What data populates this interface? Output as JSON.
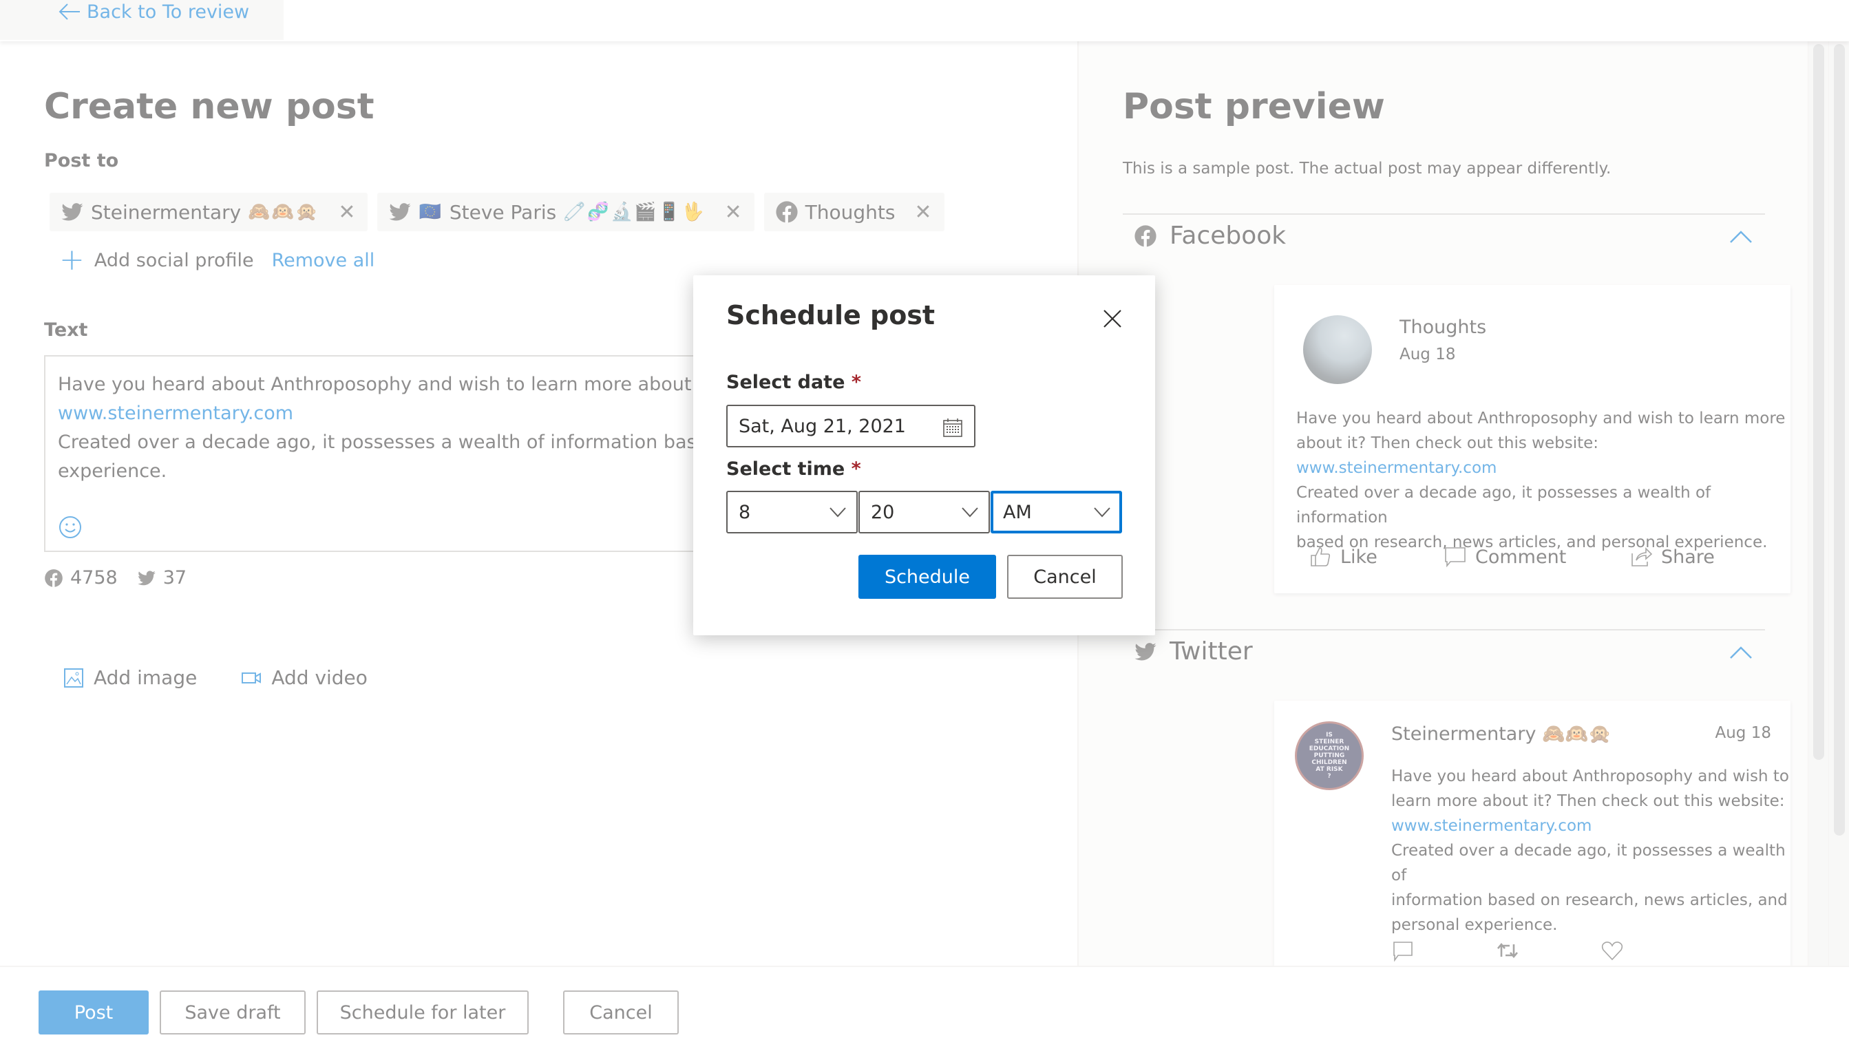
{
  "header": {
    "back_label": "Back to To review"
  },
  "composer": {
    "title": "Create new post",
    "post_to_label": "Post to",
    "profiles": [
      {
        "network": "twitter",
        "name": "Steinermentary",
        "emoji": "🙈🙉🙊"
      },
      {
        "network": "twitter",
        "name": "Steve Paris",
        "prefix_emoji": "🇪🇺",
        "emoji": "🧷🧬🔬🎬📱🖖"
      },
      {
        "network": "facebook",
        "name": "Thoughts",
        "emoji": ""
      }
    ],
    "remove_chip_glyph": "✕",
    "add_profile_label": "Add social profile",
    "remove_all_label": "Remove all",
    "text_label": "Text",
    "text_lines": [
      "Have you heard about Anthroposophy and wish to learn more about it? Then check out this website:",
      "www.steinermentary.com",
      "Created over a decade ago, it possesses a wealth of information based on research, news articles, and personal",
      "experience."
    ],
    "char_counts": {
      "facebook": "4758",
      "twitter": "37"
    },
    "add_image_label": "Add image",
    "add_video_label": "Add video"
  },
  "preview": {
    "title": "Post preview",
    "note": "This is a sample post. The actual post may appear differently.",
    "facebook": {
      "section_label": "Facebook",
      "name": "Thoughts",
      "date": "Aug 18",
      "body_lines": [
        "Have you heard about Anthroposophy and wish to learn more",
        "about it? Then check out this website:",
        "www.steinermentary.com",
        "Created over a decade ago, it possesses a wealth of information",
        "based on research, news articles, and personal experience."
      ],
      "actions": [
        "Like",
        "Comment",
        "Share"
      ]
    },
    "twitter": {
      "section_label": "Twitter",
      "name": "Steinermentary 🙈🙉🙊",
      "date": "Aug 18",
      "avatar_text": [
        "IS",
        "STEINER",
        "EDUCATION",
        "PUTTING",
        "CHILDREN",
        "AT RISK",
        "?"
      ],
      "body_lines": [
        "Have you heard about Anthroposophy and wish to",
        "learn more about it? Then check out this website:",
        "www.steinermentary.com",
        "Created over a decade ago, it possesses a wealth of",
        "information based on research, news articles, and",
        "personal experience."
      ]
    }
  },
  "footer": {
    "post_label": "Post",
    "save_draft_label": "Save draft",
    "schedule_later_label": "Schedule for later",
    "cancel_label": "Cancel"
  },
  "dialog": {
    "title": "Schedule post",
    "date_label": "Select date",
    "time_label": "Select time",
    "required_mark": "*",
    "date_value": "Sat, Aug 21, 2021",
    "hour_value": "8",
    "minute_value": "20",
    "ampm_value": "AM",
    "schedule_label": "Schedule",
    "cancel_label": "Cancel"
  },
  "colors": {
    "accent": "#0078d4",
    "required": "#a4262c"
  }
}
